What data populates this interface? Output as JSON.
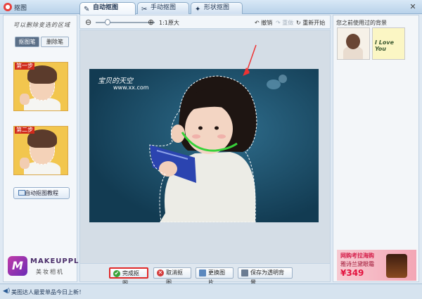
{
  "window": {
    "title": "抠图",
    "close_glyph": "✕"
  },
  "tabs": [
    {
      "label": "自动抠图",
      "icon": "✎"
    },
    {
      "label": "手动抠图",
      "icon": "✂"
    },
    {
      "label": "形状抠图",
      "icon": "✦"
    }
  ],
  "left_panel": {
    "hint": "可以删除变选的区域",
    "tool_selected": "抠图笔",
    "tool_other": "删除笔",
    "step1_label": "第一步",
    "step2_label": "第二步",
    "tutorial_button": "自动抠图教程"
  },
  "logo": {
    "name": "MAKEUPPLUS",
    "sub": "美妆相机",
    "mark": "M"
  },
  "toolbar": {
    "zoom_out": "⊖",
    "zoom_in": "⊕",
    "original_size": "1:1原大",
    "undo": "撤销",
    "redo": "重做",
    "restart": "重新开始"
  },
  "photo": {
    "watermark": "宝贝的天空",
    "watermark_url": "www.xx.com"
  },
  "bottom_buttons": {
    "done": "完成抠图",
    "cancel": "取消抠图",
    "change": "更换图片",
    "save": "保存为透明背景"
  },
  "right_panel": {
    "recent_title": "您之前使用过的背景",
    "bg2_text": "I Love You"
  },
  "ad": {
    "line1": "网购考拉海购",
    "line2": "雅诗兰黛眼霜",
    "price": "¥349"
  },
  "status": {
    "icon": "◀)",
    "text": "美图达人最爱单品今日上新！"
  },
  "colors": {
    "accent_red": "#e02a2a",
    "selection_green": "#38d23a",
    "photo_bg": "#1c4c66"
  }
}
